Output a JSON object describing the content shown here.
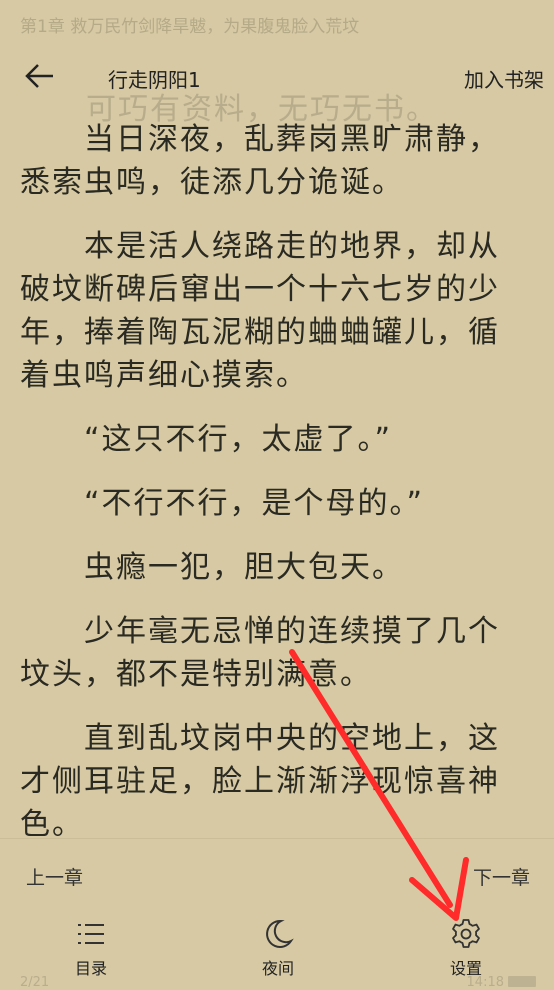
{
  "header": {
    "chapter_title": "第1章 救万民竹剑降旱魃，为果腹鬼脸入荒坟",
    "book_title": "行走阴阳1",
    "add_to_shelf": "加入书架",
    "ghost_text": "可巧有资料，无巧无书。"
  },
  "content": {
    "paragraphs": [
      "当日深夜，乱葬岗黑旷肃静，悉索虫鸣，徒添几分诡诞。",
      "本是活人绕路走的地界，却从破坟断碑后窜出一个十六七岁的少年，捧着陶瓦泥糊的蛐蛐罐儿，循着虫鸣声细心摸索。",
      "“这只不行，太虚了。”",
      "“不行不行，是个母的。”",
      "虫瘾一犯，胆大包天。",
      "少年毫无忌惮的连续摸了几个坟头，都不是特别满意。",
      "直到乱坟岗中央的空地上，这才侧耳驻足，脸上渐渐浮现惊喜神色。"
    ]
  },
  "bottom": {
    "prev_chapter": "上一章",
    "next_chapter": "下一章",
    "menu": [
      {
        "label": "目录",
        "icon": "list-icon"
      },
      {
        "label": "夜间",
        "icon": "moon-icon"
      },
      {
        "label": "设置",
        "icon": "gear-icon"
      }
    ],
    "page_indicator": "2/21",
    "time": "14:18"
  },
  "colors": {
    "background": "#d6c9a3",
    "text": "#2a2a22",
    "annotation_arrow": "#ff2a2a"
  }
}
